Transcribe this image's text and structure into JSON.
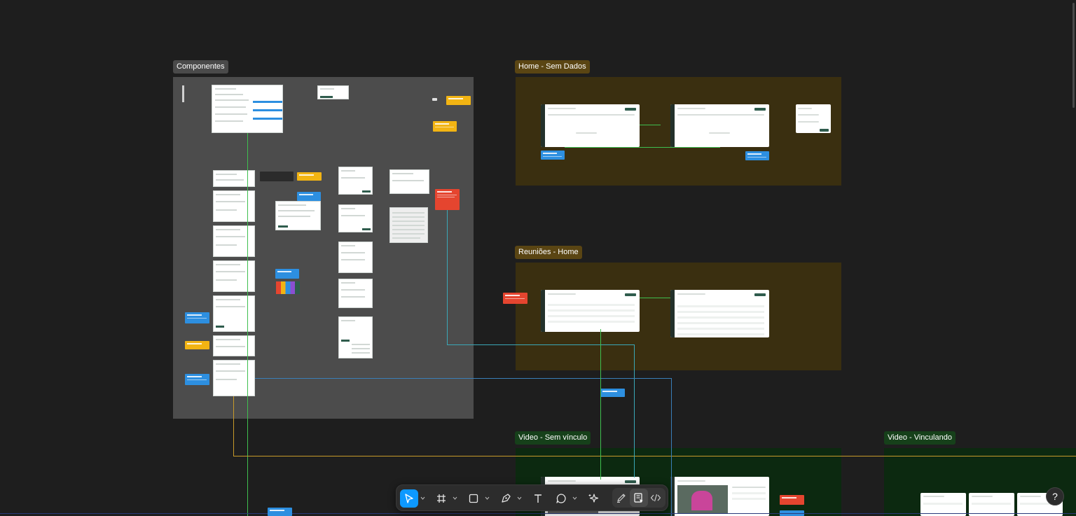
{
  "sections": [
    {
      "id": "componentes",
      "label": "Componentes"
    },
    {
      "id": "home-sem-dados",
      "label": "Home - Sem Dados"
    },
    {
      "id": "reunioes-home",
      "label": "Reuniões - Home"
    },
    {
      "id": "video-sem-vinculo",
      "label": "Video - Sem vínculo"
    },
    {
      "id": "video-vinculando",
      "label": "Video - Vinculando"
    }
  ],
  "colors": {
    "canvas": "#1e1e1e",
    "componentes_bg": "#4c4c4c",
    "home_bg": "#3a2f10",
    "video_bg": "#0c2910",
    "note_blue": "#2d8fe0",
    "note_yellow": "#f2b413",
    "note_red": "#e5452f",
    "accent": "#0d99ff"
  },
  "toolbar": {
    "tools": [
      {
        "name": "move-tool",
        "icon": "cursor-icon",
        "active": true
      },
      {
        "name": "frame-tool",
        "icon": "hash-icon",
        "active": false
      },
      {
        "name": "shape-tool",
        "icon": "rectangle-icon",
        "active": false
      },
      {
        "name": "pen-tool",
        "icon": "pen-icon",
        "active": false
      },
      {
        "name": "text-tool",
        "icon": "text-icon",
        "active": false
      },
      {
        "name": "comment-tool",
        "icon": "comment-icon",
        "active": false
      },
      {
        "name": "actions-tool",
        "icon": "sparkle-icon",
        "active": false
      }
    ],
    "modes": [
      {
        "name": "draw-mode",
        "icon": "pencil-icon"
      },
      {
        "name": "design-mode",
        "icon": "layout-icon"
      },
      {
        "name": "dev-mode",
        "icon": "code-icon"
      }
    ]
  },
  "help": {
    "label": "?"
  }
}
